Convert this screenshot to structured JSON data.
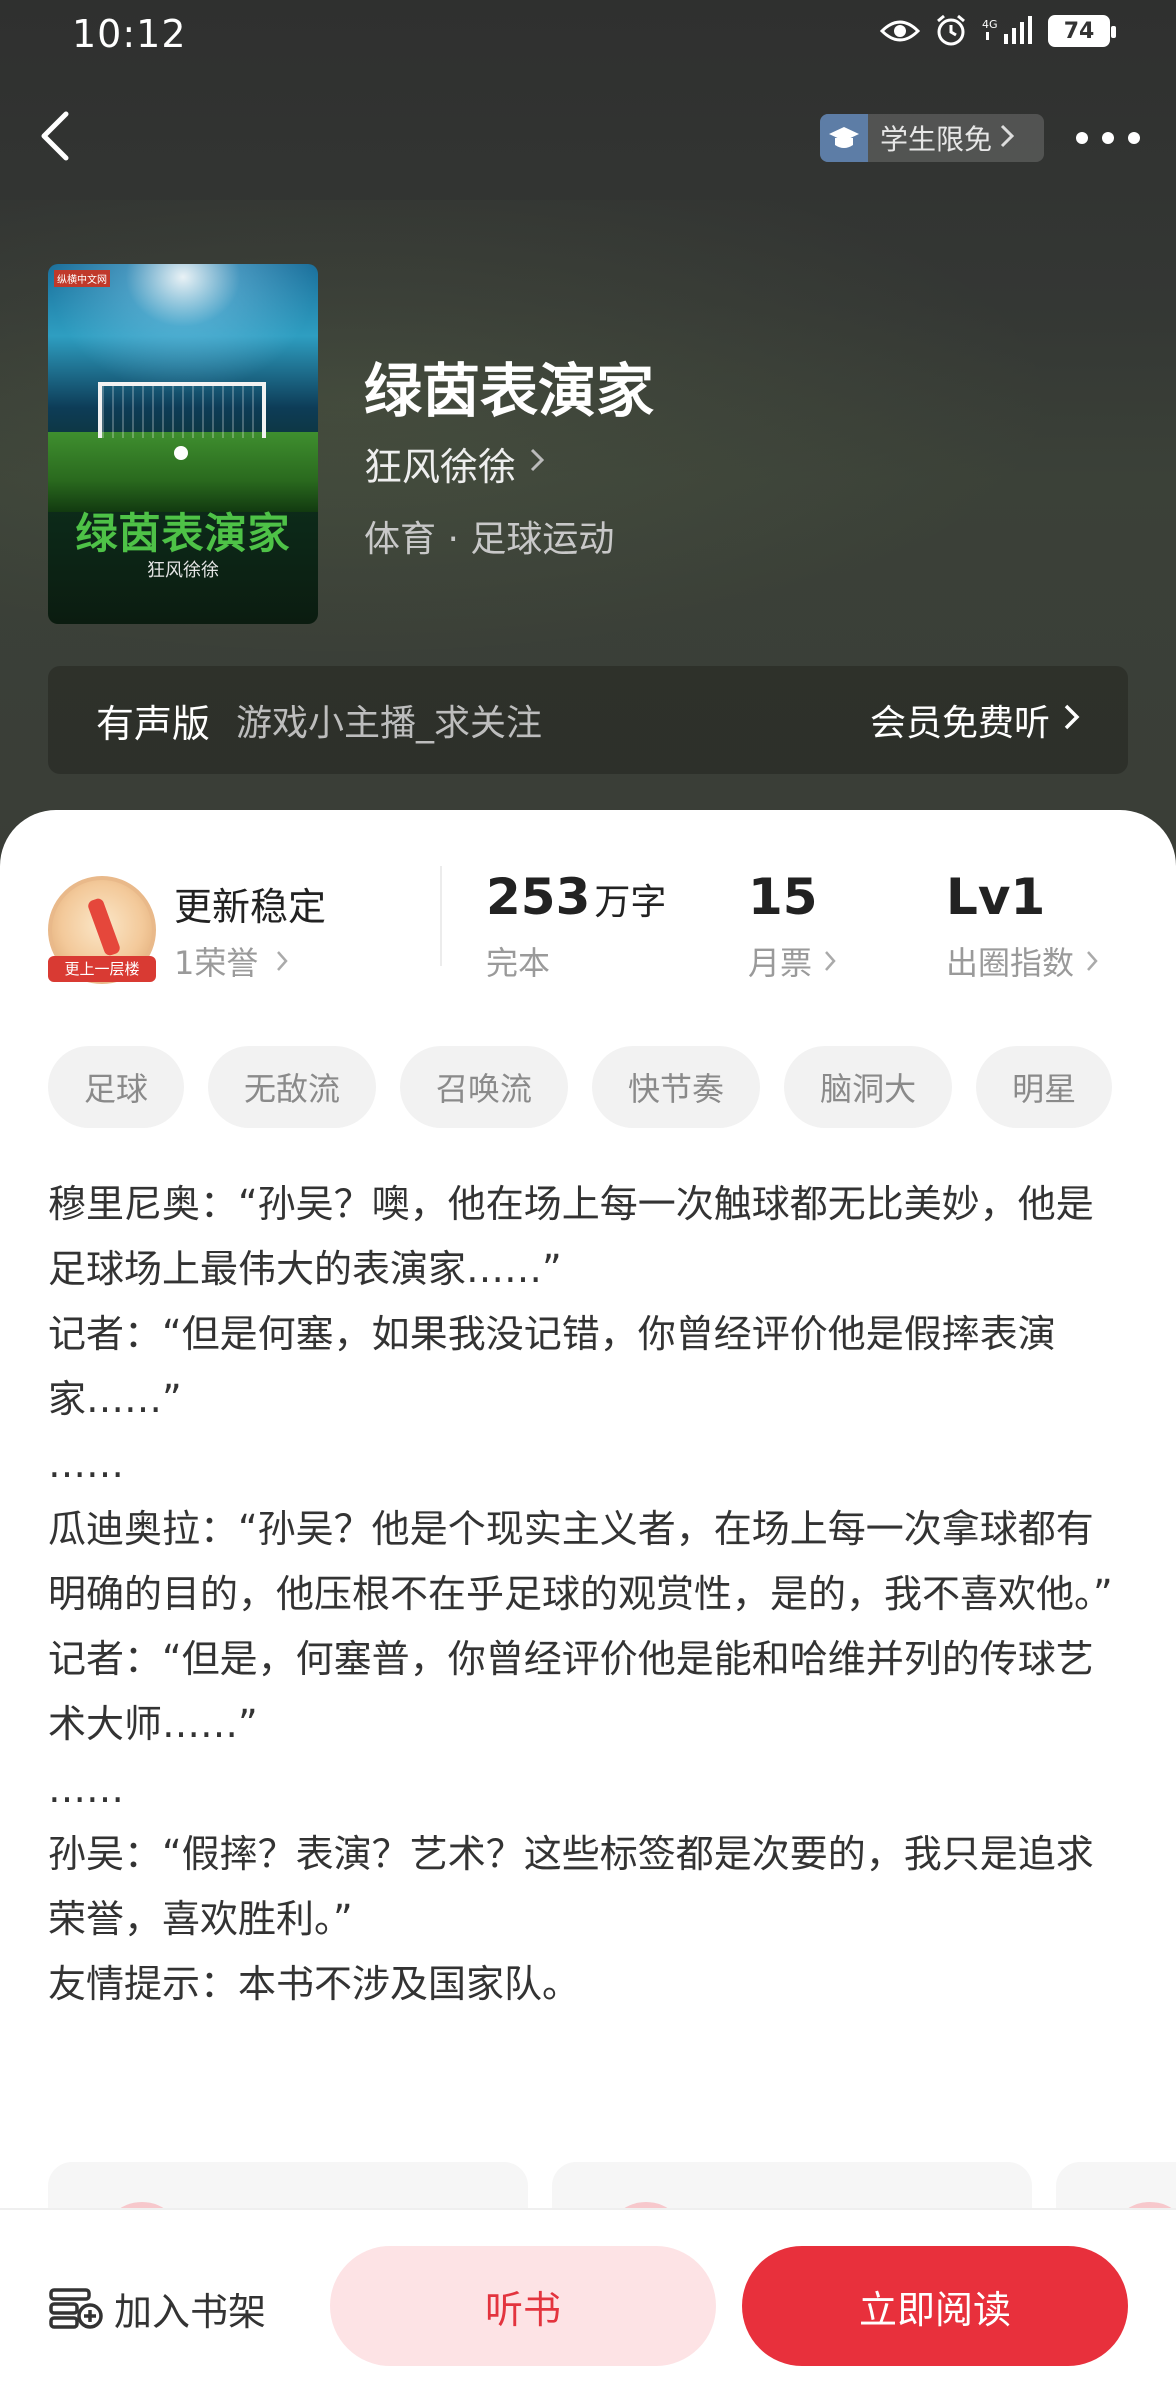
{
  "status_bar": {
    "time": "10:12",
    "network": "4G",
    "battery": "74"
  },
  "header": {
    "student_badge_label": "学生限免"
  },
  "book": {
    "title": "绿茵表演家",
    "author": "狂风徐徐",
    "genre": "体育 · 足球运动",
    "cover": {
      "publisher": "纵横中文网",
      "title": "绿茵表演家",
      "author": "狂风徐徐"
    }
  },
  "audio": {
    "label": "有声版",
    "narrator": "游戏小主播_求关注",
    "action": "会员免费听"
  },
  "stats": {
    "honor_badge_text": "更上一层楼",
    "update_title": "更新稳定",
    "honor_count": "1荣誉",
    "word_count": "253",
    "word_unit": "万字",
    "status": "完本",
    "monthly_tickets": "15",
    "monthly_tickets_label": "月票",
    "level": "Lv1",
    "level_label": "出圈指数"
  },
  "tags": [
    "足球",
    "无敌流",
    "召唤流",
    "快节奏",
    "脑洞大",
    "明星"
  ],
  "synopsis": [
    "穆里尼奥：“孙吴？噢，他在场上每一次触球都无比美妙，他是足球场上最伟大的表演家……”",
    "记者：“但是何塞，如果我没记错，你曾经评价他是假摔表演家……”",
    "……",
    "瓜迪奥拉：“孙吴？他是个现实主义者，在场上每一次拿球都有明确的目的，他压根不在乎足球的观赏性，是的，我不喜欢他。”",
    "记者：“但是，何塞普，你曾经评价他是能和哈维并列的传球艺术大师……”",
    "……",
    "孙吴：“假摔？表演？艺术？这些标签都是次要的，我只是追求荣誉，喜欢胜利。”",
    "友情提示：本书不涉及国家队。"
  ],
  "bottom_bar": {
    "add_shelf": "加入书架",
    "listen": "听书",
    "read_now": "立即阅读"
  },
  "colors": {
    "accent": "#e8303c",
    "accent_light": "#fde3e5",
    "hero_bg": "#343734"
  }
}
